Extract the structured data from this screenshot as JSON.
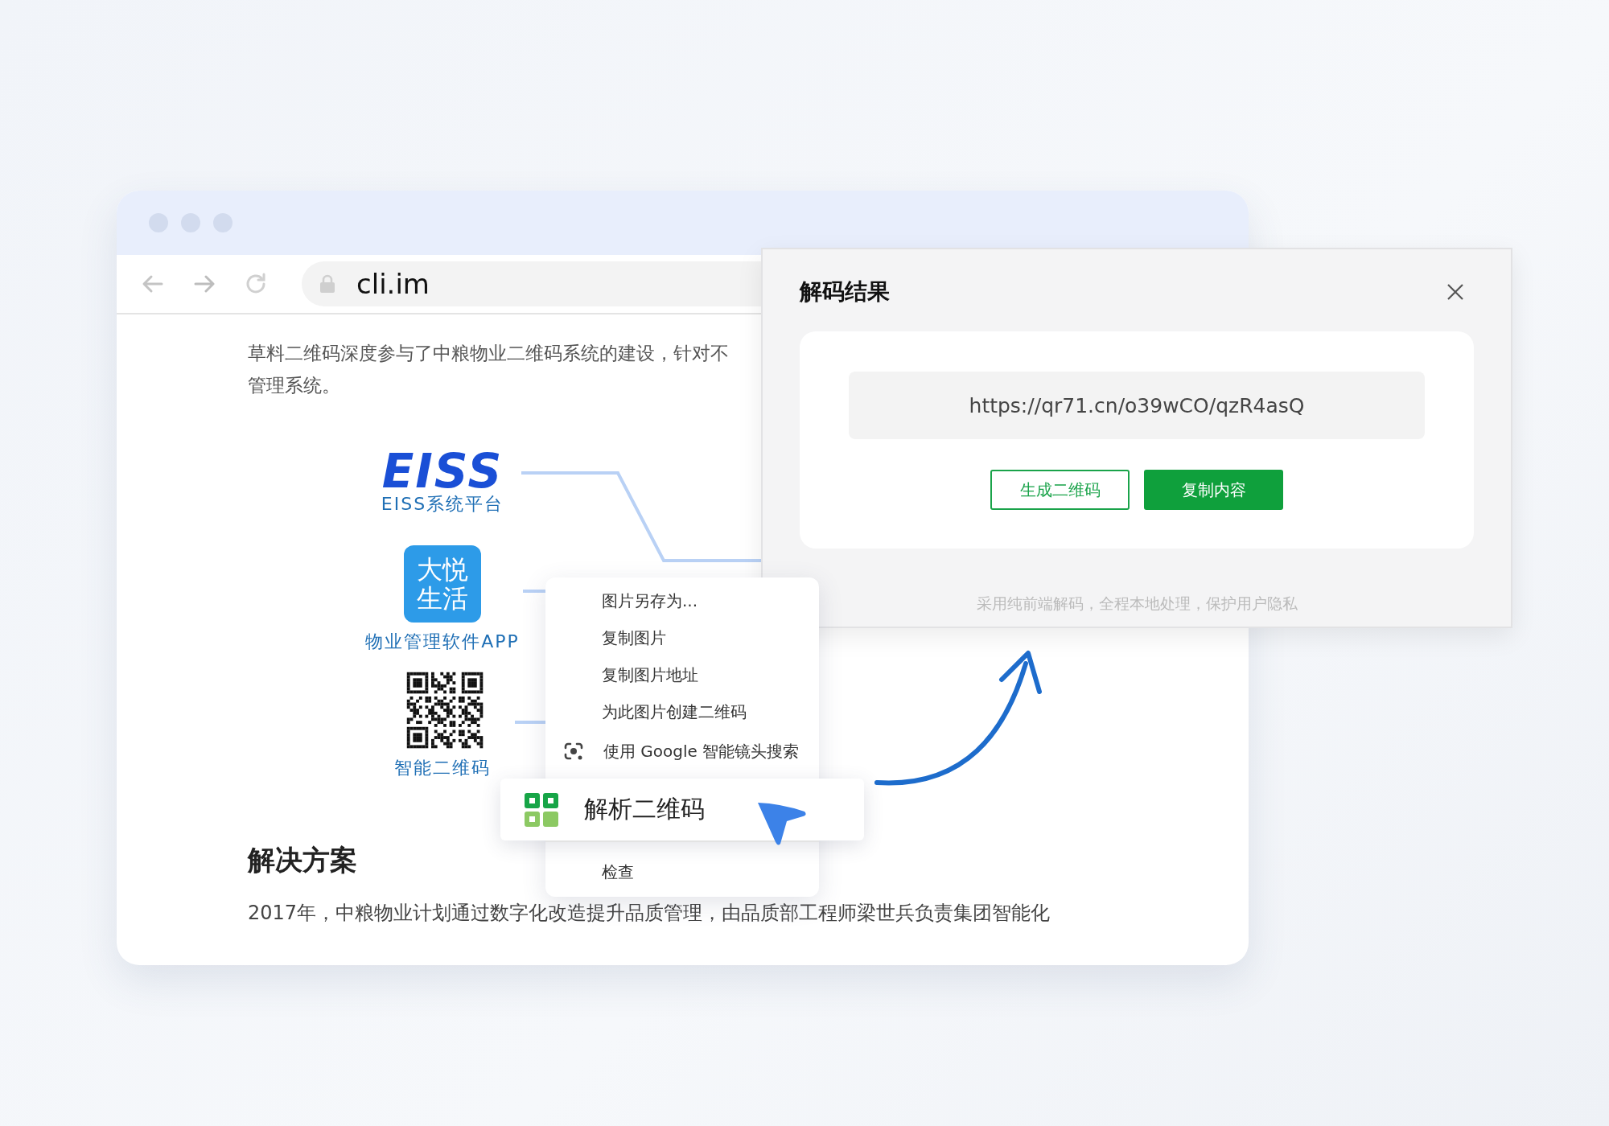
{
  "browser": {
    "address": "cli.im"
  },
  "page": {
    "intro_lines": [
      "草料二维码深度参与了中粮物业二维码系统的建设，针对不",
      "管理系统。"
    ],
    "diagram_nodes": [
      {
        "kind": "wordmark",
        "mark_text": "EISS",
        "label": "EISS系统平台"
      },
      {
        "kind": "app",
        "icon_lines": [
          "大悦",
          "生活"
        ],
        "label": "物业管理软件APP"
      },
      {
        "kind": "qr",
        "label": "智能二维码"
      }
    ],
    "section_heading": "解决方案",
    "body": "2017年，中粮物业计划通过数字化改造提升品质管理，由品质部工程师梁世兵负责集团智能化"
  },
  "context_menu": {
    "items": [
      {
        "label": "图片另存为...",
        "kind": "plain"
      },
      {
        "label": "复制图片",
        "kind": "plain"
      },
      {
        "label": "复制图片地址",
        "kind": "plain"
      },
      {
        "label": "为此图片创建二维码",
        "kind": "plain"
      },
      {
        "label": "使用 Google 智能镜头搜索",
        "kind": "lens"
      },
      {
        "label": "解析二维码",
        "kind": "highlight"
      },
      {
        "label": "检查",
        "kind": "plain"
      }
    ]
  },
  "dialog": {
    "title": "解码结果",
    "result": "https://qr71.cn/o39wCO/qzR4asQ",
    "buttons": [
      {
        "label": "生成二维码",
        "kind": "outline"
      },
      {
        "label": "复制内容",
        "kind": "primary"
      }
    ],
    "note": "采用纯前端解码，全程本地处理，保护用户隐私"
  }
}
